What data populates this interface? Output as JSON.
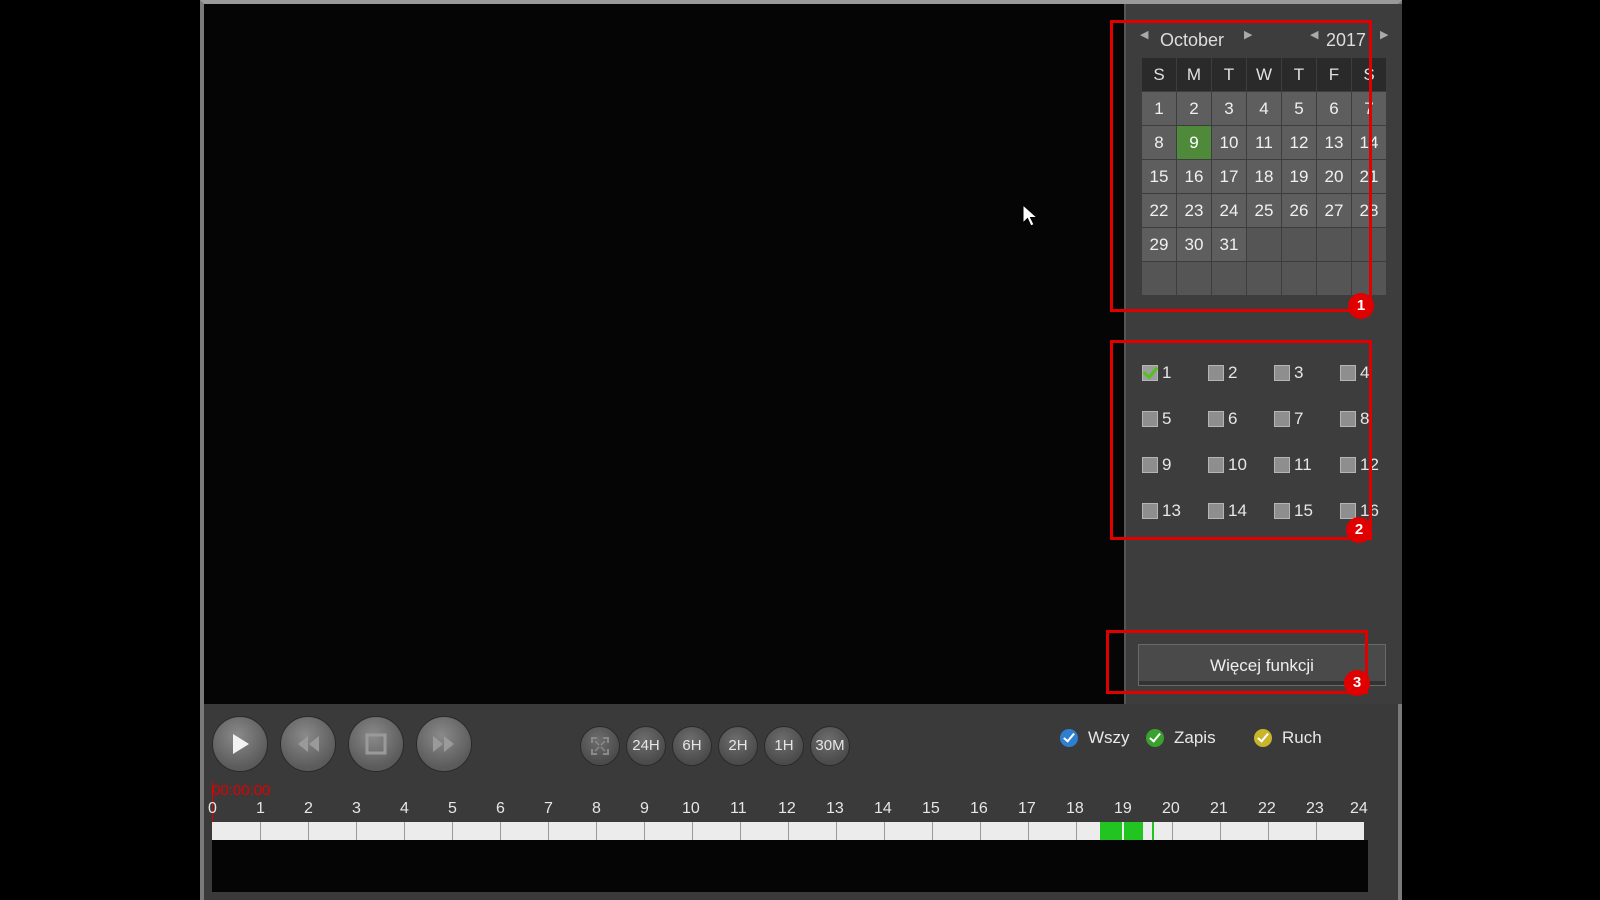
{
  "calendar": {
    "month": "October",
    "year": "2017",
    "weekdays": [
      "S",
      "M",
      "T",
      "W",
      "T",
      "F",
      "S"
    ],
    "weeks": [
      [
        "1",
        "2",
        "3",
        "4",
        "5",
        "6",
        "7"
      ],
      [
        "8",
        "9",
        "10",
        "11",
        "12",
        "13",
        "14"
      ],
      [
        "15",
        "16",
        "17",
        "18",
        "19",
        "20",
        "21"
      ],
      [
        "22",
        "23",
        "24",
        "25",
        "26",
        "27",
        "28"
      ],
      [
        "29",
        "30",
        "31",
        "",
        "",
        "",
        ""
      ],
      [
        "",
        "",
        "",
        "",
        "",
        "",
        ""
      ]
    ],
    "selected_day": "9"
  },
  "channels": {
    "labels": [
      "1",
      "2",
      "3",
      "4",
      "5",
      "6",
      "7",
      "8",
      "9",
      "10",
      "11",
      "12",
      "13",
      "14",
      "15",
      "16"
    ],
    "checked": [
      "1"
    ]
  },
  "more_functions_label": "Więcej funkcji",
  "annotations": [
    "1",
    "2",
    "3"
  ],
  "playback": {
    "buttons": [
      "play-icon",
      "rewind-icon",
      "stop-icon",
      "fast-forward-icon"
    ]
  },
  "zoom": {
    "labels": [
      "24H",
      "6H",
      "2H",
      "1H",
      "30M"
    ]
  },
  "legend": [
    {
      "label": "Wszy",
      "color": "#2f7fd0"
    },
    {
      "label": "Zapis",
      "color": "#3aa12f"
    },
    {
      "label": "Ruch",
      "color": "#c9b52a"
    }
  ],
  "timeline": {
    "time_readout": "00:00:00",
    "hour_labels": [
      "0",
      "1",
      "2",
      "3",
      "4",
      "5",
      "6",
      "7",
      "8",
      "9",
      "10",
      "11",
      "12",
      "13",
      "14",
      "15",
      "16",
      "17",
      "18",
      "19",
      "20",
      "21",
      "22",
      "23",
      "24"
    ],
    "recordings_hours": [
      [
        18.5,
        18.95
      ],
      [
        19.0,
        19.4
      ],
      [
        19.58,
        19.63
      ]
    ],
    "record_color": "#21c421"
  }
}
